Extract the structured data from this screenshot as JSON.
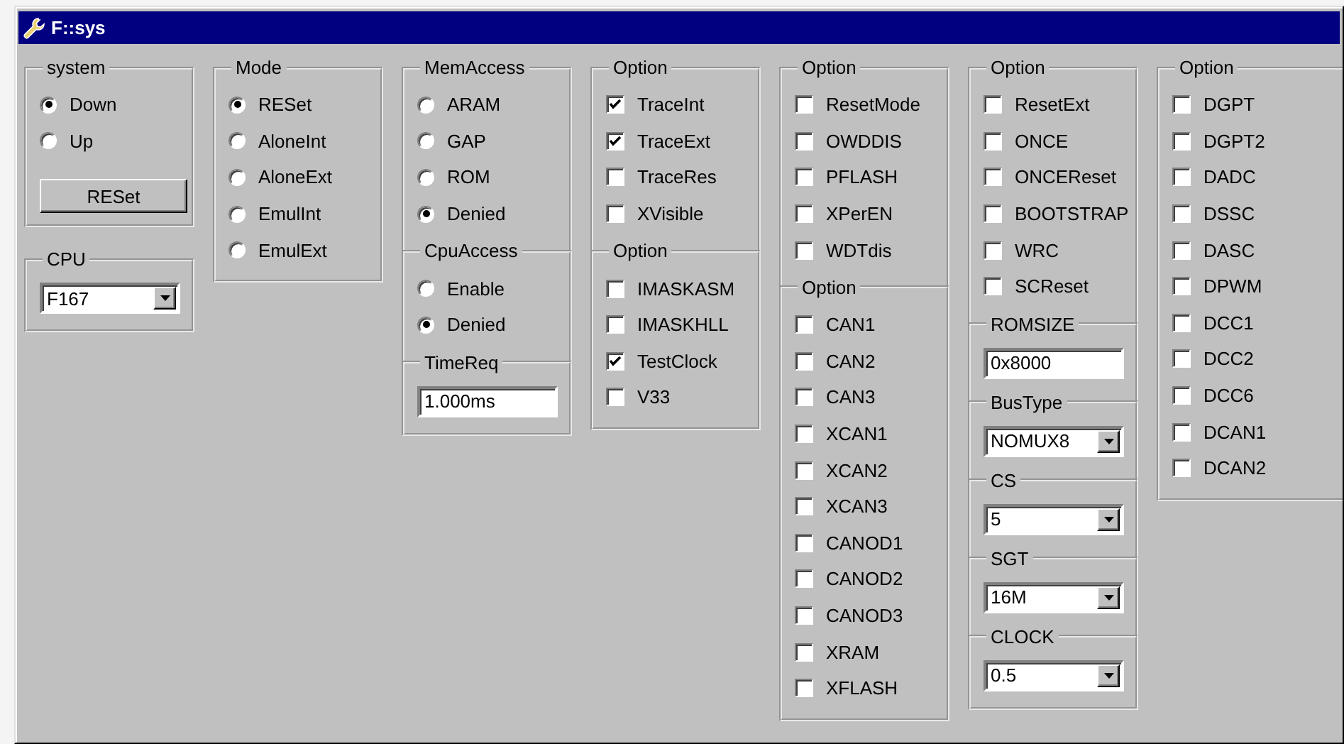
{
  "window": {
    "title": "F::sys"
  },
  "columns": [
    {
      "boxes": [
        {
          "sections": [
            {
              "title": "system",
              "items": [
                {
                  "kind": "radio",
                  "label": "Down",
                  "selected": true
                },
                {
                  "kind": "radio",
                  "label": "Up",
                  "selected": false
                },
                {
                  "kind": "button",
                  "label": "RESet"
                }
              ]
            }
          ]
        },
        {
          "sections": [
            {
              "title": "CPU",
              "items": [
                {
                  "kind": "select",
                  "value": "F167"
                }
              ]
            }
          ]
        }
      ]
    },
    {
      "boxes": [
        {
          "sections": [
            {
              "title": "Mode",
              "items": [
                {
                  "kind": "radio",
                  "label": "RESet",
                  "selected": true
                },
                {
                  "kind": "radio",
                  "label": "AloneInt",
                  "selected": false
                },
                {
                  "kind": "radio",
                  "label": "AloneExt",
                  "selected": false
                },
                {
                  "kind": "radio",
                  "label": "EmulInt",
                  "selected": false
                },
                {
                  "kind": "radio",
                  "label": "EmulExt",
                  "selected": false
                }
              ]
            }
          ]
        }
      ]
    },
    {
      "boxes": [
        {
          "sections": [
            {
              "title": "MemAccess",
              "items": [
                {
                  "kind": "radio",
                  "label": "ARAM",
                  "selected": false
                },
                {
                  "kind": "radio",
                  "label": "GAP",
                  "selected": false
                },
                {
                  "kind": "radio",
                  "label": "ROM",
                  "selected": false
                },
                {
                  "kind": "radio",
                  "label": "Denied",
                  "selected": true
                }
              ]
            },
            {
              "title": "CpuAccess",
              "items": [
                {
                  "kind": "radio",
                  "label": "Enable",
                  "selected": false
                },
                {
                  "kind": "radio",
                  "label": "Denied",
                  "selected": true
                }
              ]
            },
            {
              "title": "TimeReq",
              "items": [
                {
                  "kind": "field",
                  "value": "1.000ms"
                }
              ]
            }
          ]
        }
      ]
    },
    {
      "boxes": [
        {
          "sections": [
            {
              "title": "Option",
              "items": [
                {
                  "kind": "checkbox",
                  "label": "TraceInt",
                  "checked": true
                },
                {
                  "kind": "checkbox",
                  "label": "TraceExt",
                  "checked": true
                },
                {
                  "kind": "checkbox",
                  "label": "TraceRes",
                  "checked": false
                },
                {
                  "kind": "checkbox",
                  "label": "XVisible",
                  "checked": false
                }
              ]
            },
            {
              "title": "Option",
              "items": [
                {
                  "kind": "checkbox",
                  "label": "IMASKASM",
                  "checked": false
                },
                {
                  "kind": "checkbox",
                  "label": "IMASKHLL",
                  "checked": false
                },
                {
                  "kind": "checkbox",
                  "label": "TestClock",
                  "checked": true
                },
                {
                  "kind": "checkbox",
                  "label": "V33",
                  "checked": false
                }
              ]
            }
          ]
        }
      ]
    },
    {
      "boxes": [
        {
          "sections": [
            {
              "title": "Option",
              "items": [
                {
                  "kind": "checkbox",
                  "label": "ResetMode",
                  "checked": false
                },
                {
                  "kind": "checkbox",
                  "label": "OWDDIS",
                  "checked": false
                },
                {
                  "kind": "checkbox",
                  "label": "PFLASH",
                  "checked": false
                },
                {
                  "kind": "checkbox",
                  "label": "XPerEN",
                  "checked": false
                },
                {
                  "kind": "checkbox",
                  "label": "WDTdis",
                  "checked": false
                }
              ]
            },
            {
              "title": "Option",
              "items": [
                {
                  "kind": "checkbox",
                  "label": "CAN1",
                  "checked": false
                },
                {
                  "kind": "checkbox",
                  "label": "CAN2",
                  "checked": false
                },
                {
                  "kind": "checkbox",
                  "label": "CAN3",
                  "checked": false
                },
                {
                  "kind": "checkbox",
                  "label": "XCAN1",
                  "checked": false
                },
                {
                  "kind": "checkbox",
                  "label": "XCAN2",
                  "checked": false
                },
                {
                  "kind": "checkbox",
                  "label": "XCAN3",
                  "checked": false
                },
                {
                  "kind": "checkbox",
                  "label": "CANOD1",
                  "checked": false
                },
                {
                  "kind": "checkbox",
                  "label": "CANOD2",
                  "checked": false
                },
                {
                  "kind": "checkbox",
                  "label": "CANOD3",
                  "checked": false
                },
                {
                  "kind": "checkbox",
                  "label": "XRAM",
                  "checked": false
                },
                {
                  "kind": "checkbox",
                  "label": "XFLASH",
                  "checked": false
                }
              ]
            }
          ]
        }
      ]
    },
    {
      "boxes": [
        {
          "sections": [
            {
              "title": "Option",
              "items": [
                {
                  "kind": "checkbox",
                  "label": "ResetExt",
                  "checked": false
                },
                {
                  "kind": "checkbox",
                  "label": "ONCE",
                  "checked": false
                },
                {
                  "kind": "checkbox",
                  "label": "ONCEReset",
                  "checked": false
                },
                {
                  "kind": "checkbox",
                  "label": "BOOTSTRAP",
                  "checked": false
                },
                {
                  "kind": "checkbox",
                  "label": "WRC",
                  "checked": false
                },
                {
                  "kind": "checkbox",
                  "label": "SCReset",
                  "checked": false
                }
              ]
            },
            {
              "title": "ROMSIZE",
              "items": [
                {
                  "kind": "field",
                  "value": "0x8000"
                }
              ]
            },
            {
              "title": "BusType",
              "items": [
                {
                  "kind": "select",
                  "value": "NOMUX8"
                }
              ]
            },
            {
              "title": "CS",
              "items": [
                {
                  "kind": "select",
                  "value": "5"
                }
              ]
            },
            {
              "title": "SGT",
              "items": [
                {
                  "kind": "select",
                  "value": "16M"
                }
              ]
            },
            {
              "title": "CLOCK",
              "items": [
                {
                  "kind": "select",
                  "value": "0.5"
                }
              ]
            }
          ]
        }
      ]
    },
    {
      "boxes": [
        {
          "sections": [
            {
              "title": "Option",
              "items": [
                {
                  "kind": "checkbox",
                  "label": "DGPT",
                  "checked": false
                },
                {
                  "kind": "checkbox",
                  "label": "DGPT2",
                  "checked": false
                },
                {
                  "kind": "checkbox",
                  "label": "DADC",
                  "checked": false
                },
                {
                  "kind": "checkbox",
                  "label": "DSSC",
                  "checked": false
                },
                {
                  "kind": "checkbox",
                  "label": "DASC",
                  "checked": false
                },
                {
                  "kind": "checkbox",
                  "label": "DPWM",
                  "checked": false
                },
                {
                  "kind": "checkbox",
                  "label": "DCC1",
                  "checked": false
                },
                {
                  "kind": "checkbox",
                  "label": "DCC2",
                  "checked": false
                },
                {
                  "kind": "checkbox",
                  "label": "DCC6",
                  "checked": false
                },
                {
                  "kind": "checkbox",
                  "label": "DCAN1",
                  "checked": false
                },
                {
                  "kind": "checkbox",
                  "label": "DCAN2",
                  "checked": false
                }
              ]
            }
          ]
        }
      ]
    }
  ]
}
